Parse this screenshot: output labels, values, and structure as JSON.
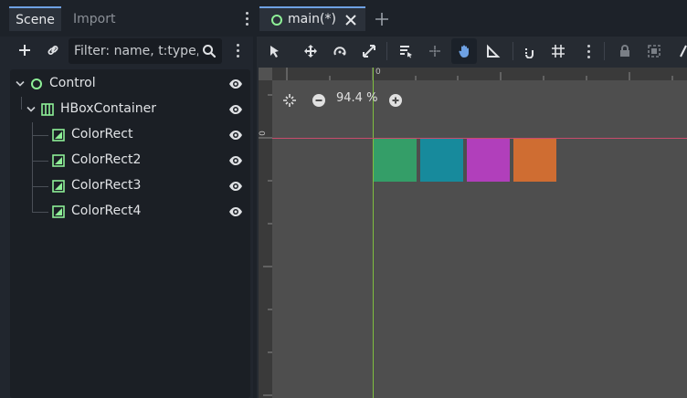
{
  "dock": {
    "tabs": [
      "Scene",
      "Import"
    ],
    "filter_placeholder": "Filter: name, t:type, g:group"
  },
  "tree": {
    "nodes": [
      {
        "label": "Control",
        "type": "control"
      },
      {
        "label": "HBoxContainer",
        "type": "hbox"
      },
      {
        "label": "ColorRect",
        "type": "colorrect"
      },
      {
        "label": "ColorRect2",
        "type": "colorrect"
      },
      {
        "label": "ColorRect3",
        "type": "colorrect"
      },
      {
        "label": "ColorRect4",
        "type": "colorrect"
      }
    ]
  },
  "editor": {
    "tab_label": "main(*)",
    "zoom": "94.4 %",
    "ruler_origin_label": "0"
  },
  "colors": {
    "accent": "#6ea1e3",
    "node_green": "#8eef97",
    "rect1": "#349e68",
    "rect2": "#178a9c",
    "rect3": "#b13fbb",
    "rect4": "#cf6d32"
  }
}
